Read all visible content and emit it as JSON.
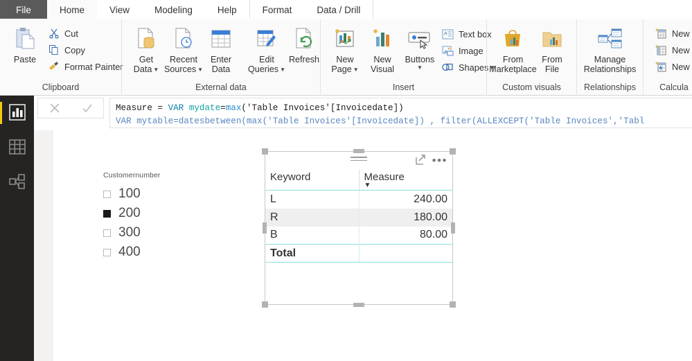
{
  "tabs": [
    {
      "label": "File",
      "state": "file"
    },
    {
      "label": "Home",
      "state": "active"
    },
    {
      "label": "View",
      "state": "normal"
    },
    {
      "label": "Modeling",
      "state": "normal"
    },
    {
      "label": "Help",
      "state": "normal"
    },
    {
      "label": "Format",
      "state": "sep"
    },
    {
      "label": "Data / Drill",
      "state": "normal"
    }
  ],
  "ribbon": {
    "clipboard": {
      "group_label": "Clipboard",
      "paste": "Paste",
      "cut": "Cut",
      "copy": "Copy",
      "format_painter": "Format Painter"
    },
    "external_data": {
      "group_label": "External data",
      "get_data_l1": "Get",
      "get_data_l2": "Data",
      "recent_sources_l1": "Recent",
      "recent_sources_l2": "Sources",
      "enter_data_l1": "Enter",
      "enter_data_l2": "Data",
      "edit_queries_l1": "Edit",
      "edit_queries_l2": "Queries",
      "refresh": "Refresh"
    },
    "insert": {
      "group_label": "Insert",
      "new_page_l1": "New",
      "new_page_l2": "Page",
      "new_visual_l1": "New",
      "new_visual_l2": "Visual",
      "buttons": "Buttons",
      "text_box": "Text box",
      "image": "Image",
      "shapes": "Shapes"
    },
    "custom_visuals": {
      "group_label": "Custom visuals",
      "from_marketplace_l1": "From",
      "from_marketplace_l2": "Marketplace",
      "from_file_l1": "From",
      "from_file_l2": "File"
    },
    "relationships": {
      "group_label": "Relationships",
      "manage_l1": "Manage",
      "manage_l2": "Relationships"
    },
    "calculations": {
      "group_label": "Calcula",
      "new_measure": "New Me",
      "new_column": "New Col",
      "new_quick": "New Qui"
    }
  },
  "formula_bar": {
    "cancel_icon": "close-icon",
    "commit_icon": "check-icon",
    "line1": {
      "p1": "Measure = ",
      "p2": "VAR ",
      "p3": "mydate",
      "p4": "=",
      "p5": "max",
      "p6": "('Table Invoices'[Invoicedate])"
    },
    "line2_visible": "VAR mytable=datesbetween(max('Table Invoices'[Invoicedate]) , filter(ALLEXCEPT('Table Invoices','Tabl"
  },
  "leftnav": {
    "items": [
      {
        "icon": "report-view-icon",
        "label": "Report view",
        "selected": true
      },
      {
        "icon": "data-view-icon",
        "label": "Data view",
        "selected": false
      },
      {
        "icon": "model-view-icon",
        "label": "Model view",
        "selected": false
      }
    ]
  },
  "slicer": {
    "title": "Customernumber",
    "items": [
      {
        "value": "100",
        "checked": false
      },
      {
        "value": "200",
        "checked": true
      },
      {
        "value": "300",
        "checked": false
      },
      {
        "value": "400",
        "checked": false
      }
    ]
  },
  "visual": {
    "focus_icon": "focus-mode-icon",
    "more_icon": "more-options-icon",
    "drag_icon": "drag-handle-icon",
    "columns": [
      "Keyword",
      "Measure"
    ],
    "sorted_column": "Measure",
    "sort_direction": "desc",
    "rows": [
      {
        "keyword": "L",
        "measure": "240.00"
      },
      {
        "keyword": "R",
        "measure": "180.00"
      },
      {
        "keyword": "B",
        "measure": "80.00"
      }
    ],
    "total_label": "Total",
    "total_value": "",
    "highlighted_row_index": 1
  },
  "colors": {
    "accent_yellow": "#f2c811",
    "nav_dark": "#252423",
    "file_tab": "#5a5a5a",
    "table_rule": "#8fe0e0",
    "row_highlight": "#efefef"
  }
}
